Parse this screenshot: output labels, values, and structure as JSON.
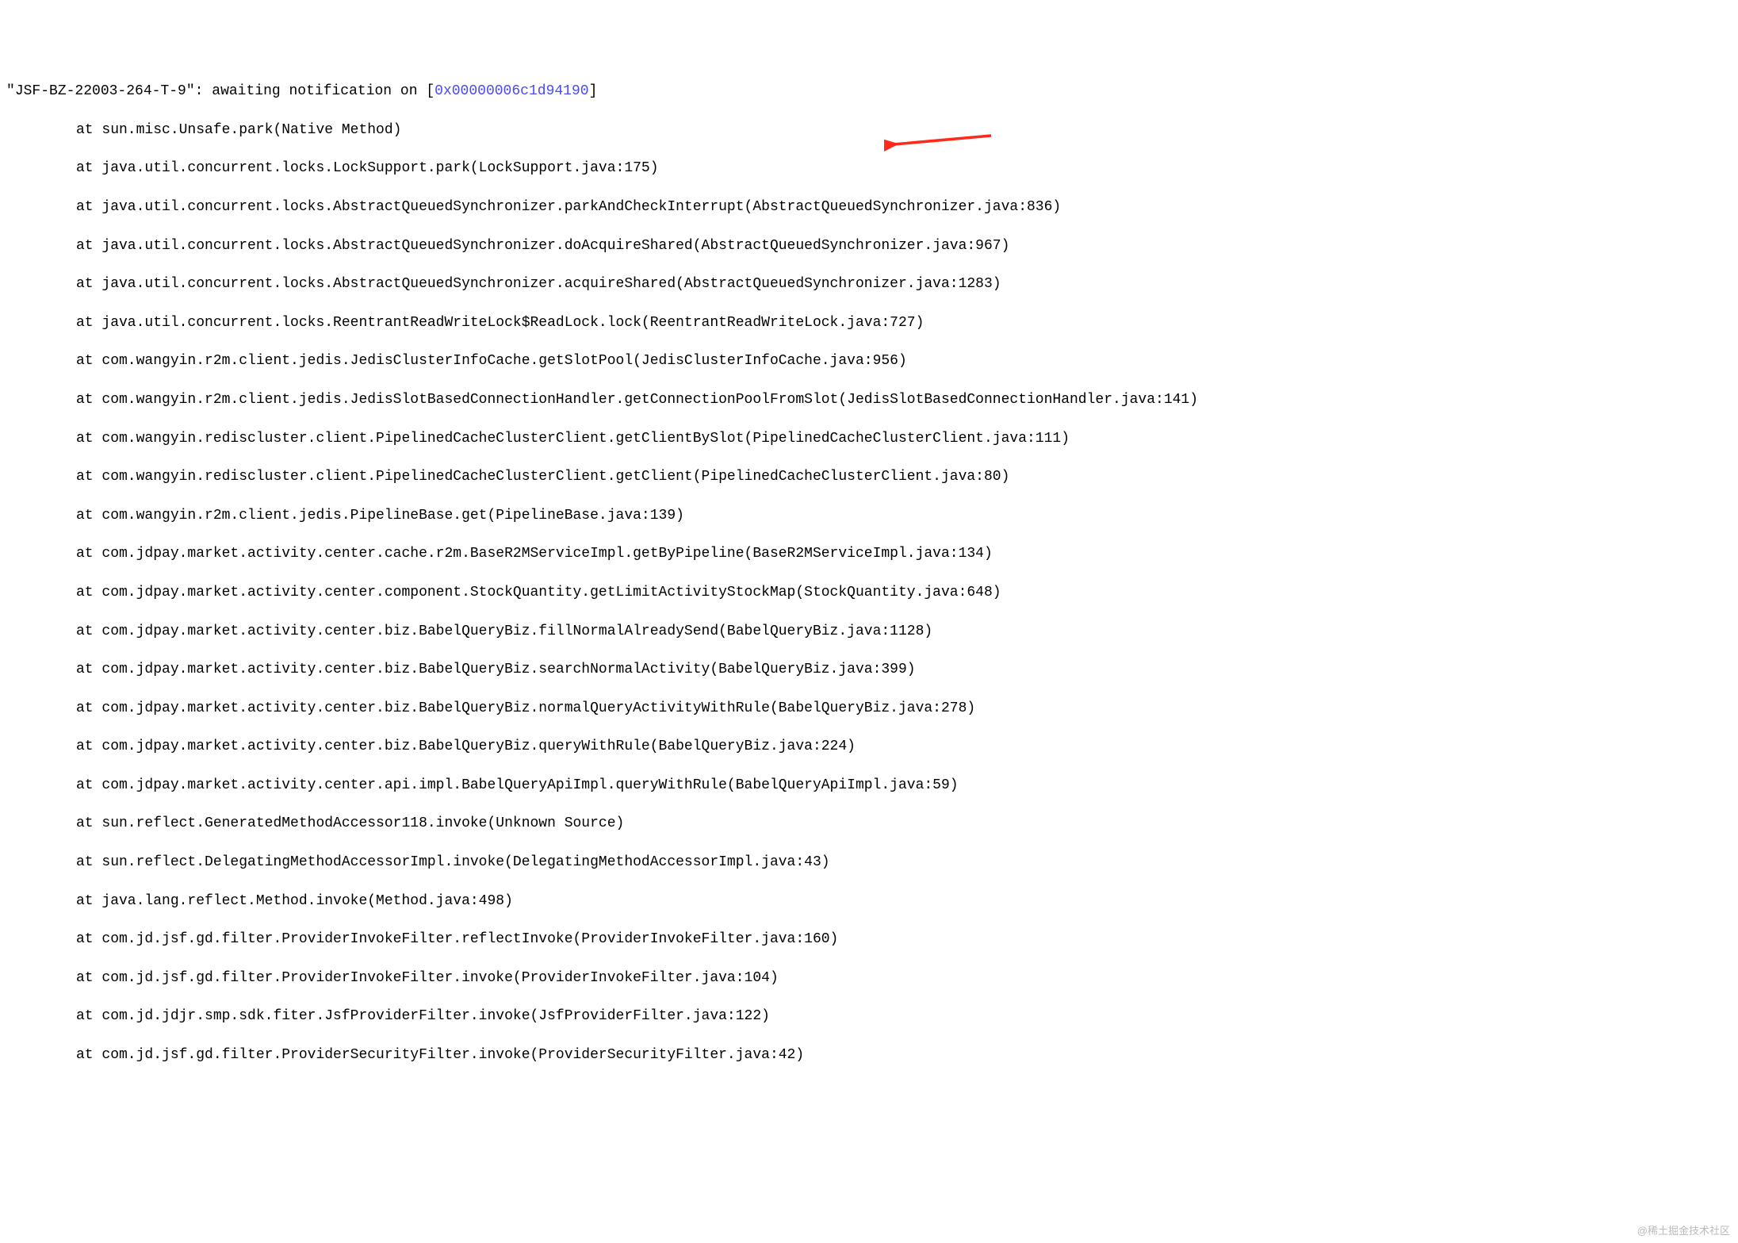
{
  "header": {
    "quote_open": "\"",
    "thread_name": "JSF-BZ-22003-264-T-9",
    "quote_close": "\"",
    "status_text": ": awaiting notification on ",
    "bracket_open": "[",
    "address": "0x00000006c1d94190",
    "bracket_close": "]"
  },
  "stack": [
    "at sun.misc.Unsafe.park(Native Method)",
    "at java.util.concurrent.locks.LockSupport.park(LockSupport.java:175)",
    "at java.util.concurrent.locks.AbstractQueuedSynchronizer.parkAndCheckInterrupt(AbstractQueuedSynchronizer.java:836)",
    "at java.util.concurrent.locks.AbstractQueuedSynchronizer.doAcquireShared(AbstractQueuedSynchronizer.java:967)",
    "at java.util.concurrent.locks.AbstractQueuedSynchronizer.acquireShared(AbstractQueuedSynchronizer.java:1283)",
    "at java.util.concurrent.locks.ReentrantReadWriteLock$ReadLock.lock(ReentrantReadWriteLock.java:727)",
    "at com.wangyin.r2m.client.jedis.JedisClusterInfoCache.getSlotPool(JedisClusterInfoCache.java:956)",
    "at com.wangyin.r2m.client.jedis.JedisSlotBasedConnectionHandler.getConnectionPoolFromSlot(JedisSlotBasedConnectionHandler.java:141)",
    "at com.wangyin.rediscluster.client.PipelinedCacheClusterClient.getClientBySlot(PipelinedCacheClusterClient.java:111)",
    "at com.wangyin.rediscluster.client.PipelinedCacheClusterClient.getClient(PipelinedCacheClusterClient.java:80)",
    "at com.wangyin.r2m.client.jedis.PipelineBase.get(PipelineBase.java:139)",
    "at com.jdpay.market.activity.center.cache.r2m.BaseR2MServiceImpl.getByPipeline(BaseR2MServiceImpl.java:134)",
    "at com.jdpay.market.activity.center.component.StockQuantity.getLimitActivityStockMap(StockQuantity.java:648)",
    "at com.jdpay.market.activity.center.biz.BabelQueryBiz.fillNormalAlreadySend(BabelQueryBiz.java:1128)",
    "at com.jdpay.market.activity.center.biz.BabelQueryBiz.searchNormalActivity(BabelQueryBiz.java:399)",
    "at com.jdpay.market.activity.center.biz.BabelQueryBiz.normalQueryActivityWithRule(BabelQueryBiz.java:278)",
    "at com.jdpay.market.activity.center.biz.BabelQueryBiz.queryWithRule(BabelQueryBiz.java:224)",
    "at com.jdpay.market.activity.center.api.impl.BabelQueryApiImpl.queryWithRule(BabelQueryApiImpl.java:59)",
    "at sun.reflect.GeneratedMethodAccessor118.invoke(Unknown Source)",
    "at sun.reflect.DelegatingMethodAccessorImpl.invoke(DelegatingMethodAccessorImpl.java:43)",
    "at java.lang.reflect.Method.invoke(Method.java:498)",
    "at com.jd.jsf.gd.filter.ProviderInvokeFilter.reflectInvoke(ProviderInvokeFilter.java:160)",
    "at com.jd.jsf.gd.filter.ProviderInvokeFilter.invoke(ProviderInvokeFilter.java:104)",
    "at com.jd.jdjr.smp.sdk.fiter.JsfProviderFilter.invoke(JsfProviderFilter.java:122)",
    "at com.jd.jsf.gd.filter.ProviderSecurityFilter.invoke(ProviderSecurityFilter.java:42)"
  ],
  "watermark": "@稀土掘金技术社区"
}
